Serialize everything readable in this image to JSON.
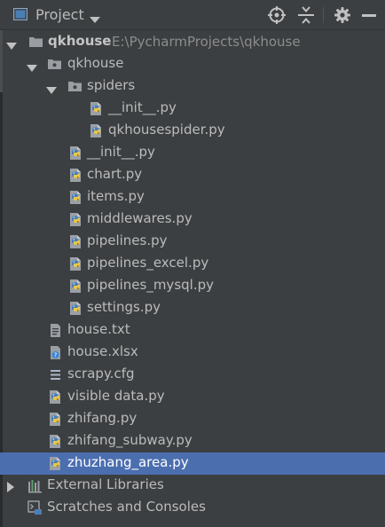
{
  "header": {
    "title": "Project",
    "icons": [
      "project-view-icon",
      "dropdown-arrow-icon",
      "locate-target-icon",
      "collapse-all-icon",
      "settings-gear-icon",
      "hide-panel-icon"
    ]
  },
  "tree": {
    "root": {
      "name": "qkhouse",
      "path": "E:\\PycharmProjects\\qkhouse"
    },
    "package": {
      "name": "qkhouse"
    },
    "spiders": {
      "name": "spiders",
      "files": [
        "__init__.py",
        "qkhousespider.py"
      ]
    },
    "package_files": [
      "__init__.py",
      "chart.py",
      "items.py",
      "middlewares.py",
      "pipelines.py",
      "pipelines_excel.py",
      "pipelines_mysql.py",
      "settings.py"
    ],
    "root_files": [
      "house.txt",
      "house.xlsx",
      "scrapy.cfg",
      "visible data.py",
      "zhifang.py",
      "zhifang_subway.py",
      "zhuzhang_area.py"
    ],
    "selected_file": "zhuzhang_area.py",
    "external_libraries": "External Libraries",
    "scratches": "Scratches and Consoles"
  },
  "colors": {
    "background": "#3c3f41",
    "selection": "#4b6eaf",
    "text": "#bbbbbb",
    "path_text": "#8c8c8c",
    "python_blue": "#4a7fb5",
    "python_yellow": "#e8c64a"
  }
}
